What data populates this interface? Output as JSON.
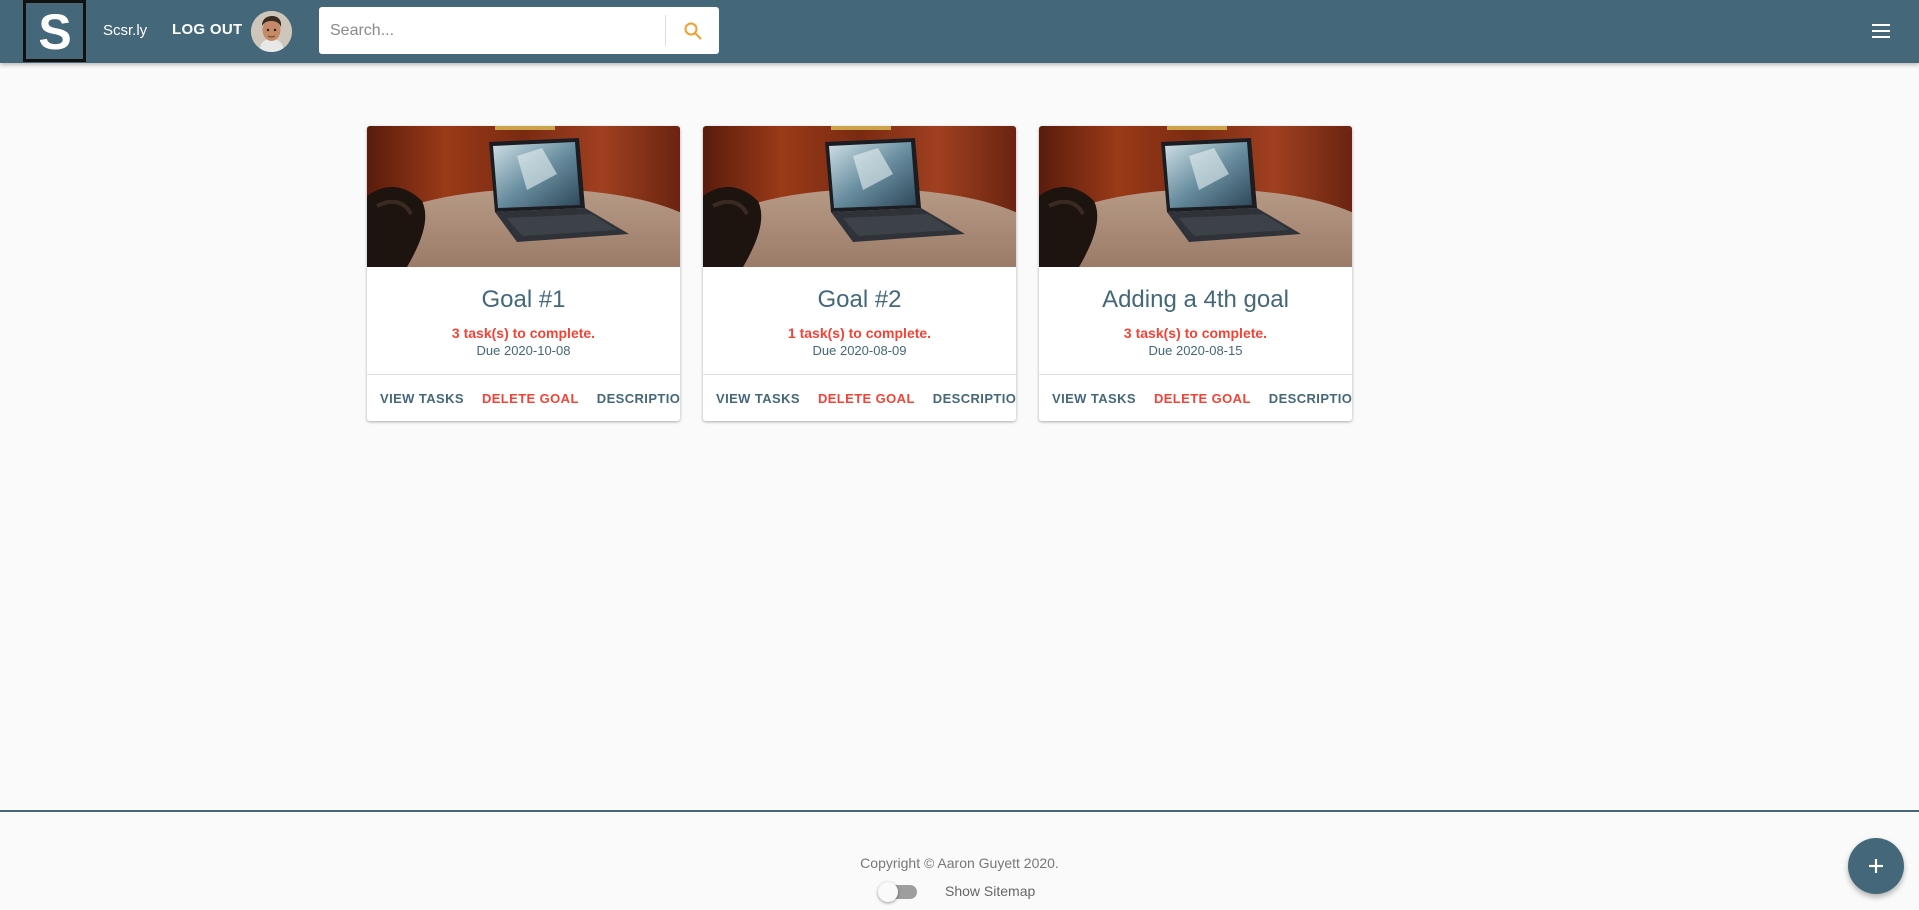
{
  "app": {
    "logo_letter": "S",
    "brand_name": "Scsr.ly",
    "logout_label": "LOG OUT"
  },
  "search": {
    "placeholder": "Search...",
    "value": ""
  },
  "goals": [
    {
      "title": "Goal #1",
      "tasks_text": "3 task(s) to complete.",
      "due_text": "Due 2020-10-08",
      "actions": {
        "view": "VIEW TASKS",
        "delete": "DELETE GOAL",
        "description": "DESCRIPTION"
      }
    },
    {
      "title": "Goal #2",
      "tasks_text": "1 task(s) to complete.",
      "due_text": "Due 2020-08-09",
      "actions": {
        "view": "VIEW TASKS",
        "delete": "DELETE GOAL",
        "description": "DESCRIPTION"
      }
    },
    {
      "title": "Adding a 4th goal",
      "tasks_text": "3 task(s) to complete.",
      "due_text": "Due 2020-08-15",
      "actions": {
        "view": "VIEW TASKS",
        "delete": "DELETE GOAL",
        "description": "DESCRIPTION"
      }
    }
  ],
  "footer": {
    "copyright": "Copyright © Aaron Guyett 2020.",
    "sitemap_label": "Show Sitemap",
    "sitemap_on": false
  },
  "icons": {
    "search": "search-icon",
    "menu": "hamburger-menu-icon",
    "add": "plus-icon",
    "avatar": "user-avatar"
  },
  "colors": {
    "primary": "#446879",
    "danger": "#f44336",
    "search_accent": "#f0a030",
    "background": "#fafafa"
  }
}
